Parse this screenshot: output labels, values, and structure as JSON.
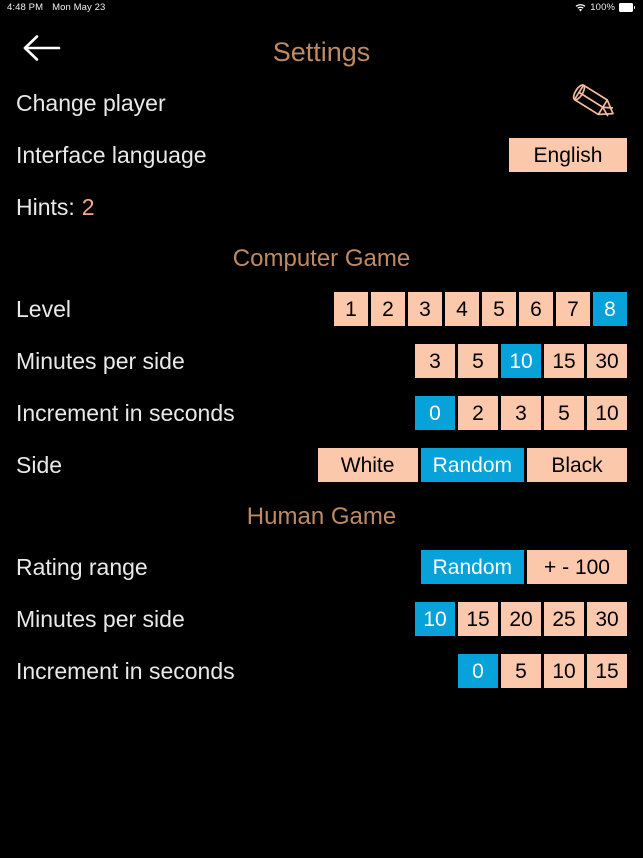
{
  "statusbar": {
    "time": "4:48 PM",
    "date": "Mon May 23",
    "battery_percent": "100%",
    "wifi_icon": "wifi-icon",
    "battery_icon": "battery-icon"
  },
  "header": {
    "back_icon": "back-arrow-icon",
    "title": "Settings"
  },
  "rows": {
    "change_player": {
      "label": "Change player",
      "icon": "pencil-icon"
    },
    "interface_language": {
      "label": "Interface language",
      "value": "English"
    },
    "hints": {
      "label": "Hints:",
      "value": "2"
    }
  },
  "computer_game": {
    "section_title": "Computer Game",
    "level": {
      "label": "Level",
      "options": [
        "1",
        "2",
        "3",
        "4",
        "5",
        "6",
        "7",
        "8"
      ],
      "selected": "8"
    },
    "minutes_per_side": {
      "label": "Minutes per side",
      "options": [
        "3",
        "5",
        "10",
        "15",
        "30"
      ],
      "selected": "10"
    },
    "increment_in_seconds": {
      "label": "Increment in seconds",
      "options": [
        "0",
        "2",
        "3",
        "5",
        "10"
      ],
      "selected": "0"
    },
    "side": {
      "label": "Side",
      "options": [
        "White",
        "Random",
        "Black"
      ],
      "selected": "Random"
    }
  },
  "human_game": {
    "section_title": "Human Game",
    "rating_range": {
      "label": "Rating range",
      "options": [
        "Random",
        "+ - 100"
      ],
      "selected": "Random"
    },
    "minutes_per_side": {
      "label": "Minutes per side",
      "options": [
        "10",
        "15",
        "20",
        "25",
        "30"
      ],
      "selected": "10"
    },
    "increment_in_seconds": {
      "label": "Increment in seconds",
      "options": [
        "0",
        "5",
        "10",
        "15"
      ],
      "selected": "0"
    }
  },
  "colors": {
    "background": "#000000",
    "accent_tan": "#bd8a63",
    "chip_peach": "#fbc8ac",
    "chip_selected_blue": "#07a2d9",
    "label_text": "#e9e9e9"
  }
}
